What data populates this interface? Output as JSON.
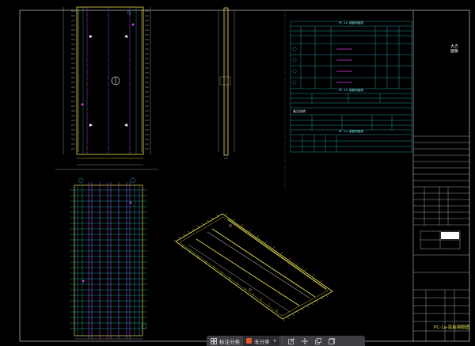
{
  "toolbar": {
    "grid_icon": "grid-icon",
    "category_label": "标注分类",
    "uncategorized_label": "未分类",
    "actions": [
      "edit-icon",
      "move-icon",
      "copy-icon",
      "layers-icon"
    ]
  },
  "title_block": {
    "vertical_title": "大方面板",
    "drawing_name": "PC-1a-底板钢筋图"
  },
  "tables": {
    "header1": "PC-1a 钢筋明细表",
    "header2": "PC-1a 钢筋明细表",
    "header3": "PC-1a 钢筋明细表",
    "note_label": "备注说明"
  },
  "colors": {
    "background": "#000000",
    "cyan": "#2fd6e8",
    "yellow": "#e8e04a",
    "magenta": "#d23fe0",
    "white": "#eaeaea",
    "toolbar_bg": "#3d3f44",
    "toolbar_accent": "#e2562a"
  }
}
